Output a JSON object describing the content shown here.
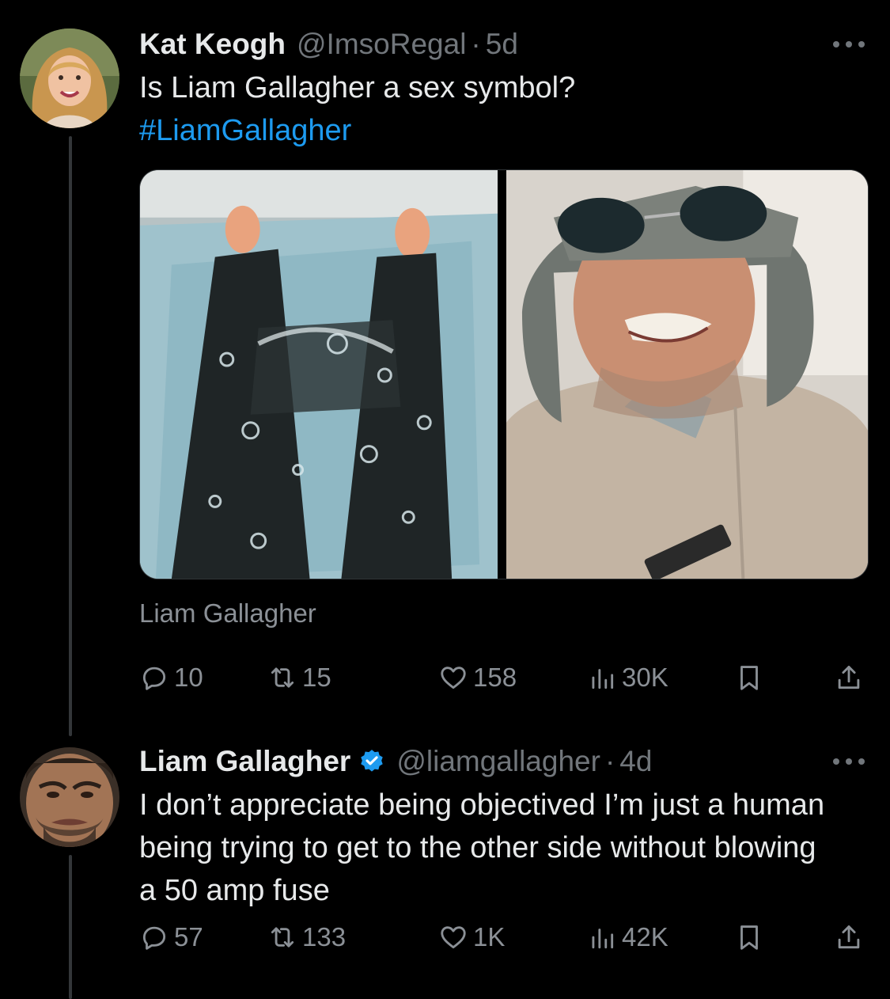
{
  "thread": {
    "tweets": [
      {
        "display_name": "Kat Keogh",
        "handle": "@ImsoRegal",
        "separator": "·",
        "age": "5d",
        "text": "Is Liam Gallagher a sex symbol?",
        "hashtag": "#LiamGallagher",
        "media_caption": "Liam Gallagher",
        "replies": "10",
        "retweets": "15",
        "likes": "158",
        "views": "30K"
      },
      {
        "display_name": "Liam Gallagher",
        "handle": "@liamgallagher",
        "separator": "·",
        "age": "4d",
        "verified": true,
        "text": "I don’t appreciate being objectived I’m just a human being trying to get to the other side without blowing a 50 amp fuse",
        "replies": "57",
        "retweets": "133",
        "likes": "1K",
        "views": "42K"
      }
    ]
  },
  "colors": {
    "background": "#000000",
    "primary_text": "#e7e9ea",
    "secondary_text": "#71767b",
    "link": "#1d9bf0",
    "thread_line": "#333639"
  },
  "icons": {
    "reply": "reply-icon",
    "retweet": "retweet-icon",
    "like": "heart-icon",
    "views": "views-icon",
    "bookmark": "bookmark-icon",
    "share": "share-icon",
    "more": "more-icon",
    "verified": "verified-badge-icon"
  }
}
